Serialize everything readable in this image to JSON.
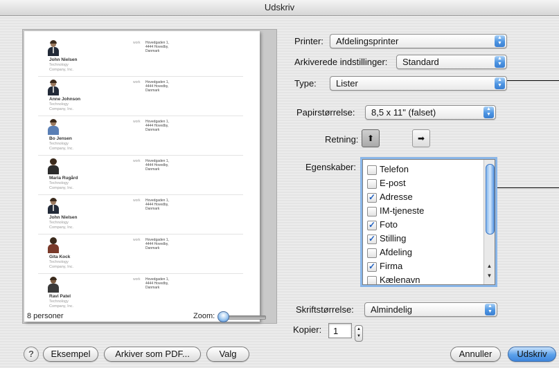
{
  "window": {
    "title": "Udskriv"
  },
  "printer": {
    "label": "Printer:",
    "value": "Afdelingsprinter"
  },
  "presets": {
    "label": "Arkiverede indstillinger:",
    "value": "Standard"
  },
  "type": {
    "label": "Type:",
    "value": "Lister"
  },
  "paper_size": {
    "label": "Papirstørrelse:",
    "value": "8,5 x 11\" (falset)"
  },
  "orientation": {
    "label": "Retning:",
    "selected": "portrait"
  },
  "properties": {
    "label": "Egenskaber:",
    "items": [
      {
        "label": "Telefon",
        "checked": false
      },
      {
        "label": "E-post",
        "checked": false
      },
      {
        "label": "Adresse",
        "checked": true
      },
      {
        "label": "IM-tjeneste",
        "checked": false
      },
      {
        "label": "Foto",
        "checked": true
      },
      {
        "label": "Stilling",
        "checked": true
      },
      {
        "label": "Afdeling",
        "checked": false
      },
      {
        "label": "Firma",
        "checked": true
      },
      {
        "label": "Kælenavn",
        "checked": false
      }
    ]
  },
  "font_size": {
    "label": "Skriftstørrelse:",
    "value": "Almindelig"
  },
  "copies": {
    "label": "Kopier:",
    "value": "1"
  },
  "preview": {
    "count_text": "8 personer",
    "zoom_label": "Zoom:",
    "contacts": [
      {
        "name": "John Nielsen",
        "title": "Technology",
        "company": "Company, Inc.",
        "addr_label": "work",
        "addr1": "Hovedgaden 1,",
        "addr2": "4444 Hovedby,",
        "addr3": "Danmark"
      },
      {
        "name": "Anne Johnson",
        "title": "Technology",
        "company": "Company, Inc.",
        "addr_label": "work",
        "addr1": "Hovedgaden 1,",
        "addr2": "4444 Hovedby,",
        "addr3": "Danmark"
      },
      {
        "name": "Bo Jensen",
        "title": "Technology",
        "company": "Company, Inc.",
        "addr_label": "work",
        "addr1": "Hovedgaden 1,",
        "addr2": "4444 Hovedby,",
        "addr3": "Danmark"
      },
      {
        "name": "Maria Rugård",
        "title": "Technology",
        "company": "Company, Inc.",
        "addr_label": "work",
        "addr1": "Hovedgaden 1,",
        "addr2": "4444 Hovedby,",
        "addr3": "Danmark"
      },
      {
        "name": "John Nielsen",
        "title": "Technology",
        "company": "Company, Inc.",
        "addr_label": "work",
        "addr1": "Hovedgaden 1,",
        "addr2": "4444 Hovedby,",
        "addr3": "Danmark"
      },
      {
        "name": "Gita Kock",
        "title": "Technology",
        "company": "Company, Inc.",
        "addr_label": "work",
        "addr1": "Hovedgaden 1,",
        "addr2": "4444 Hovedby,",
        "addr3": "Danmark"
      },
      {
        "name": "Ravi Patel",
        "title": "Technology",
        "company": "Company, Inc.",
        "addr_label": "work",
        "addr1": "Hovedgaden 1,",
        "addr2": "4444 Hovedby,",
        "addr3": "Danmark"
      }
    ]
  },
  "buttons": {
    "help": "?",
    "preview": "Eksempel",
    "save_pdf": "Arkiver som PDF...",
    "options": "Valg",
    "cancel": "Annuller",
    "print": "Udskriv"
  }
}
